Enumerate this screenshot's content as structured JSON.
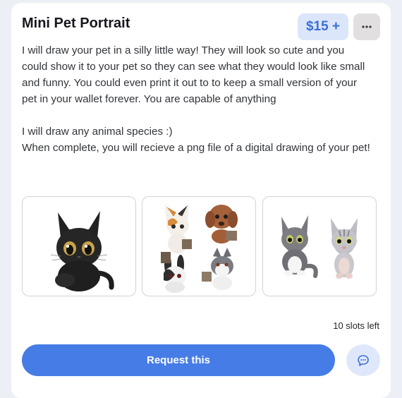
{
  "card": {
    "title": "Mini Pet Portrait",
    "price_label": "$15 +",
    "more_icon": "ellipsis-icon",
    "description": [
      "I will draw your pet in a silly little way! They will look so cute and you could show it to your pet so they can see what they would look like small and funny. You could even print it out to to keep a small version of your pet in your wallet forever. You are capable of anything",
      "I will draw any animal species :)",
      "When complete, you will recieve a png file of a digital drawing of your pet!"
    ],
    "gallery": [
      {
        "subject": "black cat drawing"
      },
      {
        "subject": "collage of pet drawings"
      },
      {
        "subject": "gray cats drawing"
      }
    ],
    "slots_text": "10 slots left",
    "request_label": "Request this",
    "chat_icon": "chat-bubble-icon"
  },
  "colors": {
    "accent": "#467ce6",
    "price_bg": "#dce6fb",
    "price_text": "#3a6fd8",
    "page_bg": "#eceff5"
  }
}
